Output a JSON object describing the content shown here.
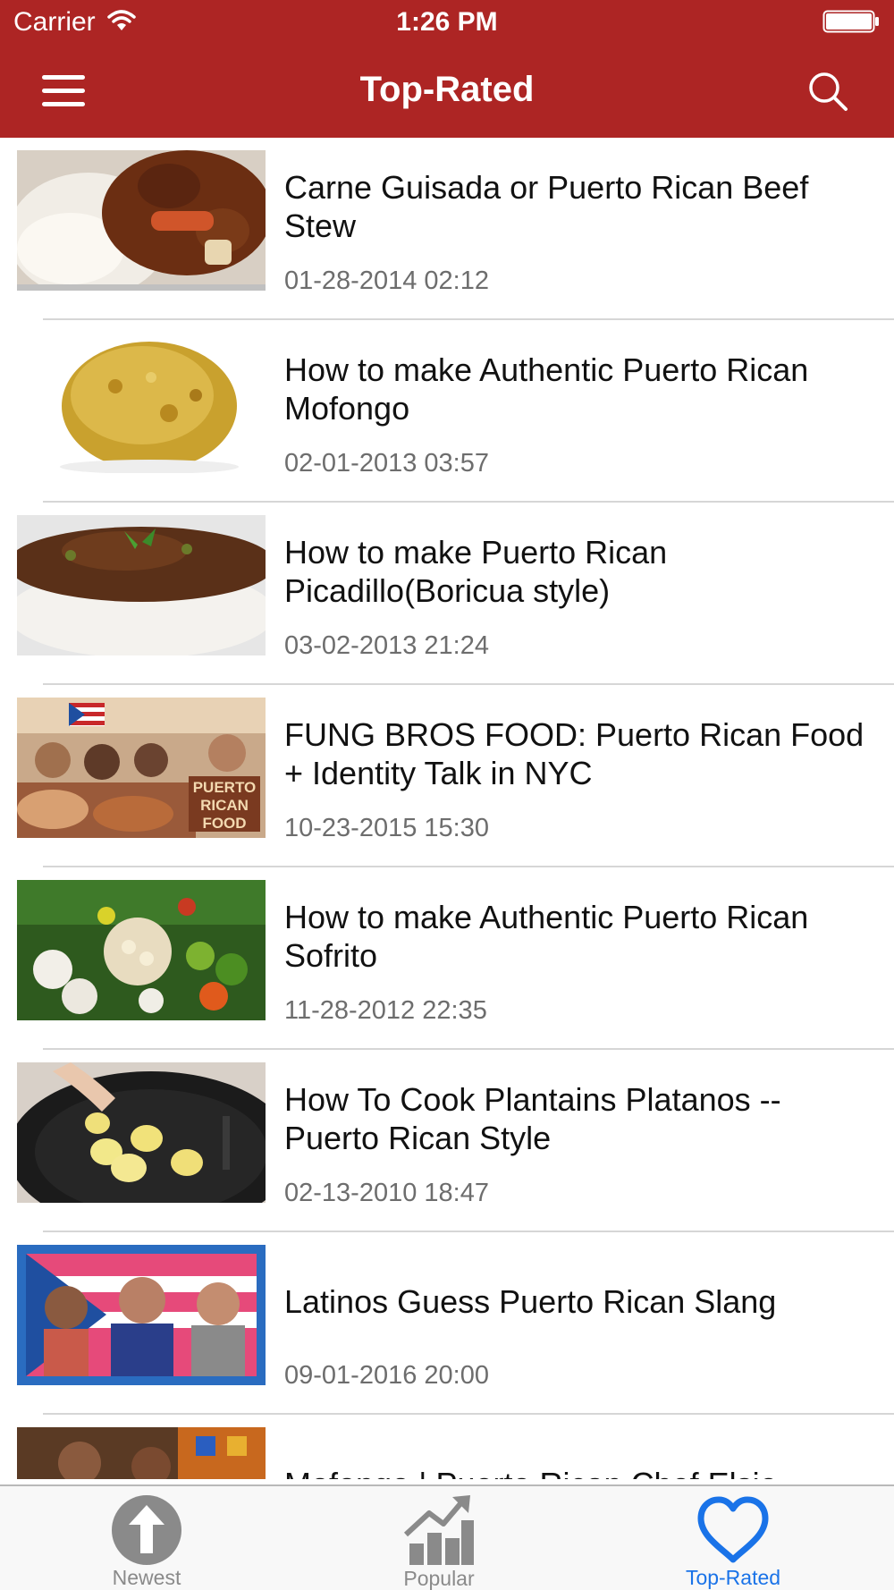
{
  "status_bar": {
    "carrier": "Carrier",
    "time": "1:26 PM"
  },
  "nav": {
    "title": "Top-Rated",
    "menu_icon": "hamburger-menu-icon",
    "search_icon": "search-icon"
  },
  "videos": [
    {
      "title": "Carne Guisada or Puerto Rican Beef Stew",
      "date": "01-28-2014 02:12"
    },
    {
      "title": "How to make Authentic Puerto Rican Mofongo",
      "date": "02-01-2013 03:57"
    },
    {
      "title": "How to make Puerto Rican Picadillo(Boricua style)",
      "date": "03-02-2013 21:24"
    },
    {
      "title": "FUNG BROS FOOD: Puerto Rican Food + Identity Talk in NYC",
      "date": "10-23-2015 15:30"
    },
    {
      "title": "How to make Authentic Puerto Rican Sofrito",
      "date": "11-28-2012 22:35"
    },
    {
      "title": "How To Cook Plantains Platanos -- Puerto Rican Style",
      "date": "02-13-2010 18:47"
    },
    {
      "title": "Latinos Guess Puerto Rican Slang",
      "date": "09-01-2016 20:00"
    },
    {
      "title": "Mofongo | Puerto Rican Chef Elsie",
      "date": ""
    }
  ],
  "thumbnail_text": {
    "puerto_rican_food": [
      "PUERTO",
      "RICAN",
      "FOOD"
    ]
  },
  "tabs": [
    {
      "label": "Newest",
      "icon": "up-arrow-circle-icon",
      "active": false
    },
    {
      "label": "Popular",
      "icon": "trending-chart-icon",
      "active": false
    },
    {
      "label": "Top-Rated",
      "icon": "heart-icon",
      "active": true
    }
  ],
  "colors": {
    "header": "#ad2524",
    "active_tab": "#1a73e8",
    "inactive_tab": "#8a8a8a"
  }
}
